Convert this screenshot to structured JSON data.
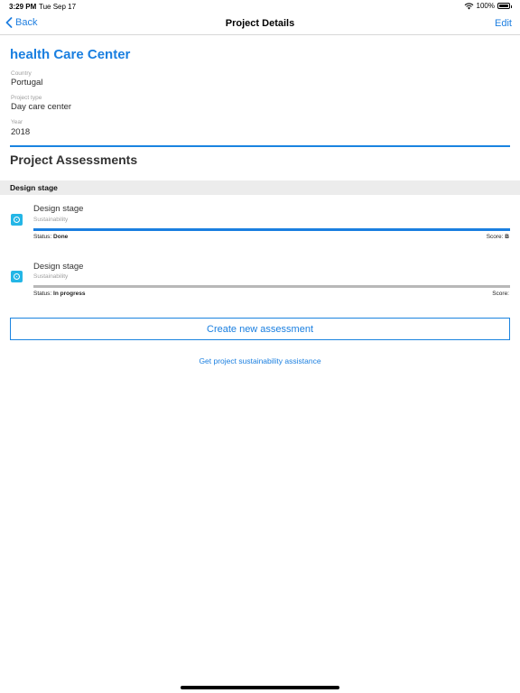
{
  "status_bar": {
    "time": "3:29 PM",
    "date": "Tue Sep 17",
    "battery": "100%"
  },
  "nav": {
    "back_label": "Back",
    "title": "Project Details",
    "edit_label": "Edit"
  },
  "project": {
    "name": "health Care Center",
    "fields": [
      {
        "label": "Country",
        "value": "Portugal"
      },
      {
        "label": "Project type",
        "value": "Day care center"
      },
      {
        "label": "Year",
        "value": "2018"
      }
    ]
  },
  "assessments": {
    "section_title": "Project Assessments",
    "group_title": "Design stage",
    "items": [
      {
        "title": "Design stage",
        "subtitle": "Sustainability",
        "status_label": "Status:",
        "status_value": "Done",
        "score_label": "Score:",
        "score_value": "B",
        "progress": 1.0,
        "bar_color": "#1a7fe0"
      },
      {
        "title": "Design stage",
        "subtitle": "Sustainability",
        "status_label": "Status:",
        "status_value": "In progress",
        "score_label": "Score:",
        "score_value": "",
        "progress": 0.0,
        "bar_color": "#1a7fe0"
      }
    ]
  },
  "actions": {
    "create_label": "Create new assessment",
    "assist_label": "Get project sustainability assistance"
  },
  "colors": {
    "accent": "#1a7fe0",
    "track": "#b8b8b8",
    "icon_bg": "#24b6e6"
  }
}
